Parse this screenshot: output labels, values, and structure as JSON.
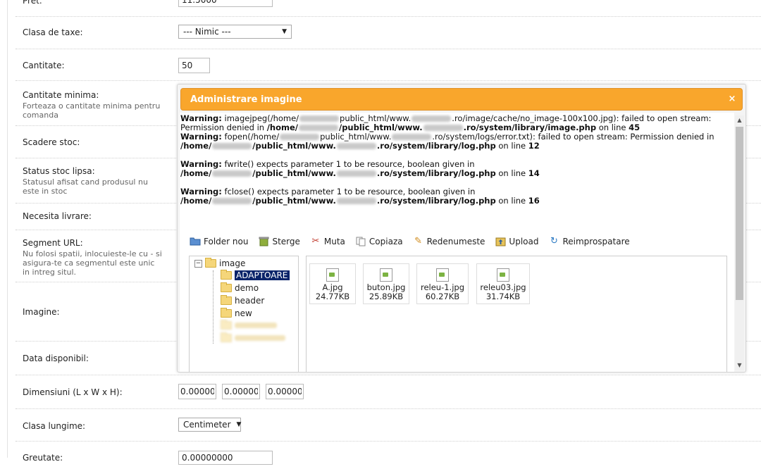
{
  "form": {
    "pret_label": "Pret:",
    "pret_value": "11.5000",
    "clasa_taxe_label": "Clasa de taxe:",
    "clasa_taxe_value": "--- Nimic ---",
    "cantitate_label": "Cantitate:",
    "cantitate_value": "50",
    "cantitate_min_label": "Cantitate minima:",
    "cantitate_min_help": "Forteaza o cantitate minima pentru comanda",
    "scadere_label": "Scadere stoc:",
    "status_label": "Status stoc lipsa:",
    "status_help": "Statusul afisat cand produsul nu este in stoc",
    "livrare_label": "Necesita livrare:",
    "seo_label": "Segment URL:",
    "seo_help": "Nu folosi spatii, inlocuieste-le cu - si asigura-te ca segmentul este unic in intreg situl.",
    "imagine_label": "Imagine:",
    "data_label": "Data disponibil:",
    "dim_label": "Dimensiuni (L x W x H):",
    "dim_l": "0.00000000",
    "dim_w": "0.00000000",
    "dim_h": "0.00000000",
    "lungime_label": "Clasa lungime:",
    "lungime_value": "Centimeter",
    "greutate_label": "Greutate:",
    "greutate_value": "0.00000000"
  },
  "modal": {
    "title": "Administrare imagine",
    "close": "×",
    "warnings": {
      "w1_label": "Warning:",
      "w1_a": "imagejpeg(/home/",
      "w1_b": "public_html/www.",
      "w1_c": ".ro/image/cache/no_image-100x100.jpg): failed to open stream: Permission denied in",
      "w1_d": "/home/",
      "w1_e": "/public_html/www.",
      "w1_f": ".ro/system/library/image.php",
      "w1_g": "on line",
      "w1_h": "45",
      "w2_label": "Warning:",
      "w2_a": "fopen(/home/",
      "w2_b": "public_html/www.",
      "w2_c": ".ro/system/logs/error.txt): failed to open stream: Permission denied in",
      "w2_d": "/home/",
      "w2_e": "/public_html/www.",
      "w2_f": ".ro/system/library/log.php",
      "w2_g": "on line",
      "w2_h": "12",
      "w3_label": "Warning:",
      "w3_a": "fwrite() expects parameter 1 to be resource, boolean given in",
      "w3_d": "/home/",
      "w3_e": "/public_html/www.",
      "w3_f": ".ro/system/library/log.php",
      "w3_g": "on line",
      "w3_h": "14",
      "w4_label": "Warning:",
      "w4_a": "fclose() expects parameter 1 to be resource, boolean given in",
      "w4_d": "/home/",
      "w4_e": "/public_html/www.",
      "w4_f": ".ro/system/library/log.php",
      "w4_g": "on line",
      "w4_h": "16"
    },
    "toolbar": {
      "folder_nou": "Folder nou",
      "sterge": "Sterge",
      "muta": "Muta",
      "copiaza": "Copiaza",
      "redenumeste": "Redenumeste",
      "upload": "Upload",
      "reimprospatare": "Reimprospatare"
    },
    "tree": {
      "root": "image",
      "minus": "−",
      "items": [
        "ADAPTOARE",
        "demo",
        "header",
        "new"
      ]
    },
    "files": [
      {
        "name": "A.jpg",
        "size": "24.77KB"
      },
      {
        "name": "buton.jpg",
        "size": "25.89KB"
      },
      {
        "name": "releu-1.jpg",
        "size": "60.27KB"
      },
      {
        "name": "releu03.jpg",
        "size": "31.74KB"
      }
    ]
  },
  "colors": {
    "modal_header": "#f9a62c",
    "tree_selected": "#0a246a"
  }
}
